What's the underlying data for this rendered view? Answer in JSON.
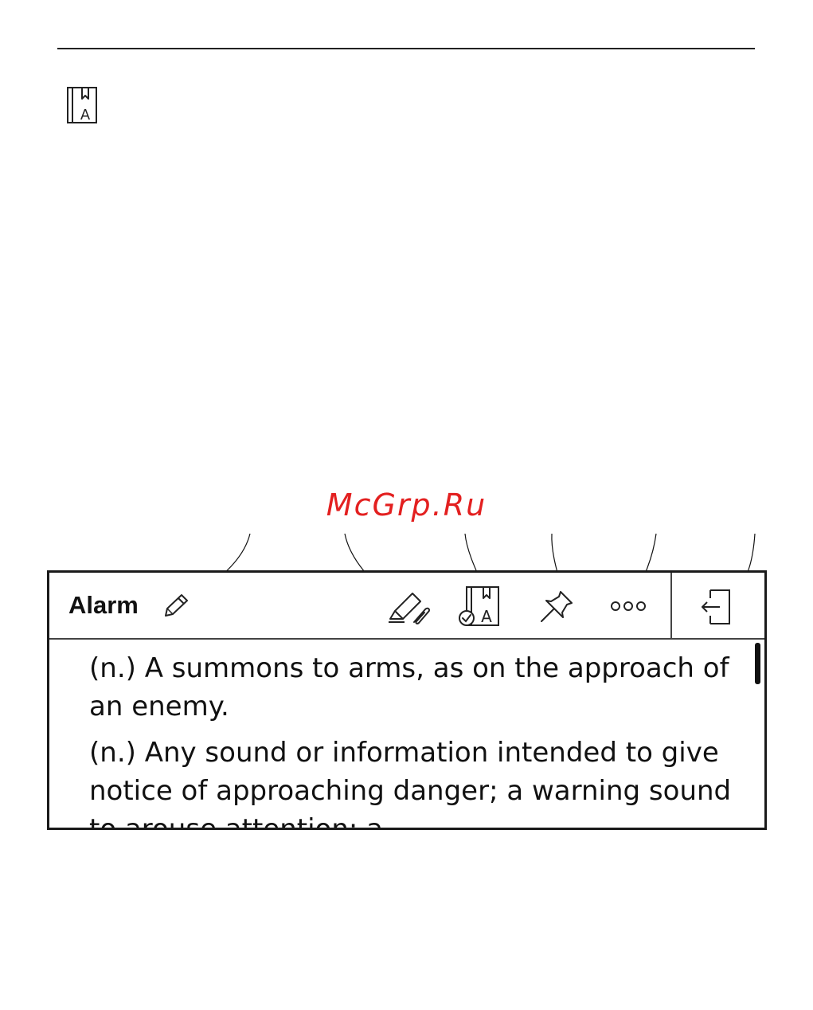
{
  "page": {
    "header_icon": "dictionary-book-icon"
  },
  "watermark": {
    "text": "McGrp.Ru",
    "color": "#e32020"
  },
  "dictionary": {
    "word": "Alarm",
    "toolbar": {
      "edit": "pencil-icon",
      "highlight": "highlighter-clip-icon",
      "dictionary": "dictionary-check-icon",
      "pin": "pushpin-icon",
      "more": "more-dots-icon",
      "exit": "exit-icon"
    },
    "definitions": [
      "(n.) A summons to arms, as on the approach of an enemy.",
      "(n.) Any sound or information intended to give notice of approaching danger; a warning sound to arouse attention; a"
    ]
  }
}
